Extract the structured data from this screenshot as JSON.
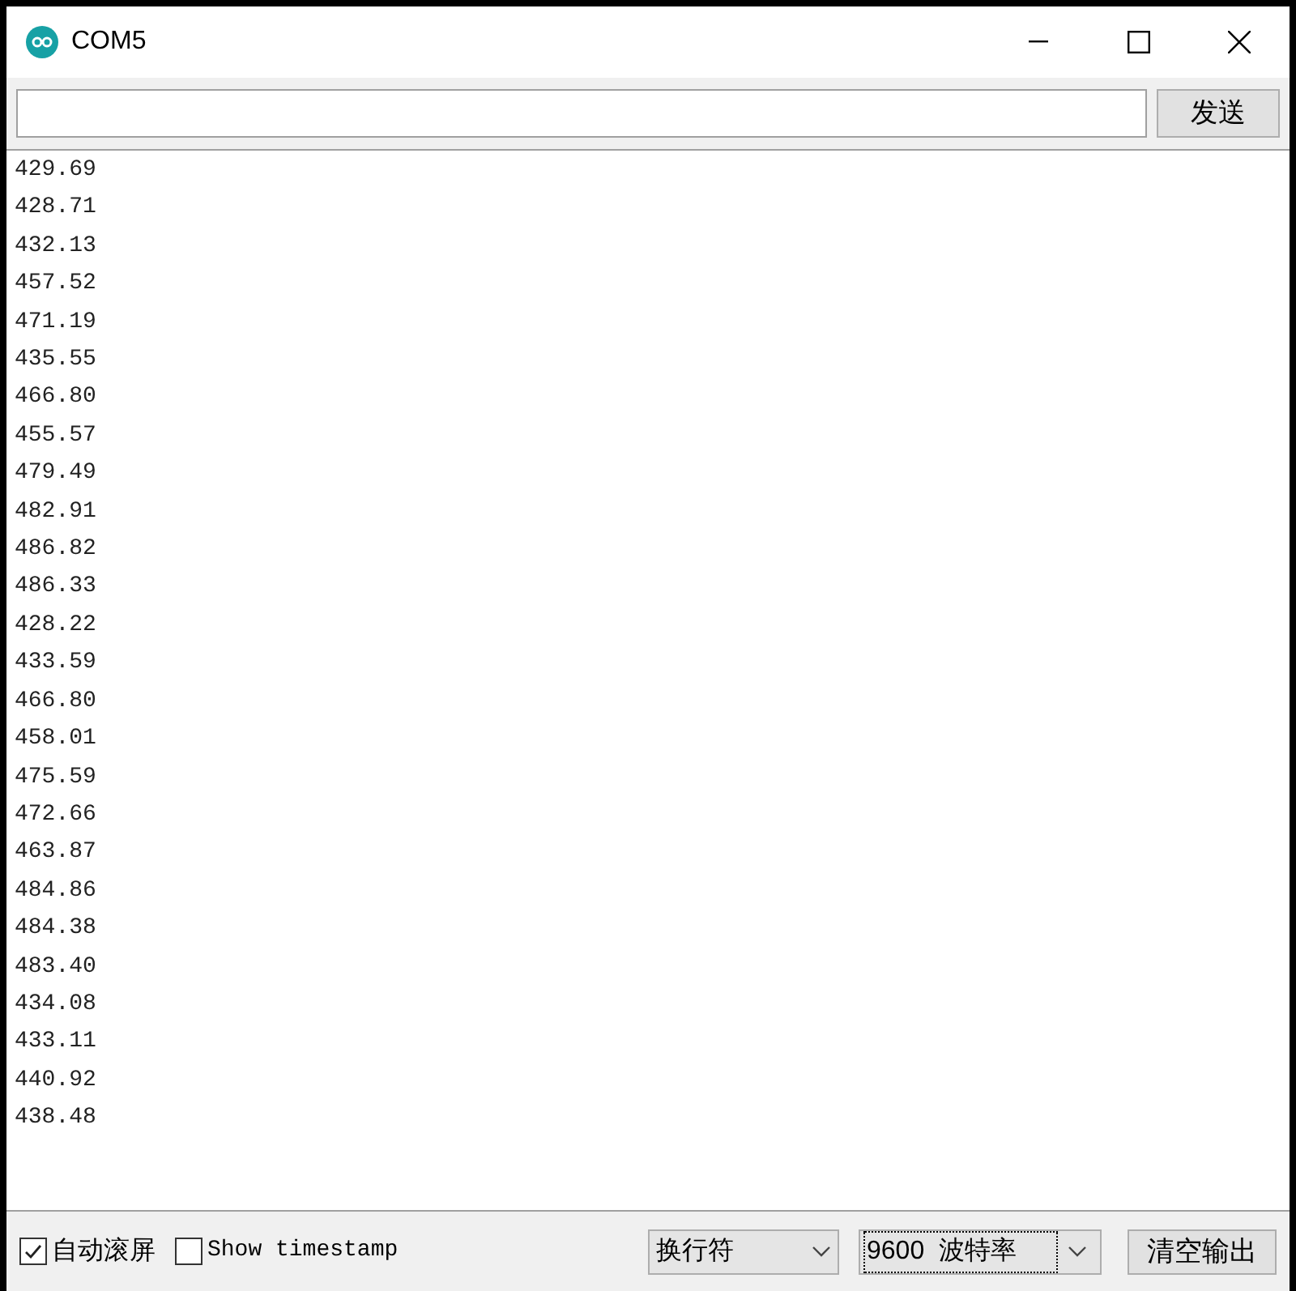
{
  "window": {
    "title": "COM5"
  },
  "send": {
    "button": "发送"
  },
  "output": [
    "429.69",
    "428.71",
    "432.13",
    "457.52",
    "471.19",
    "435.55",
    "466.80",
    "455.57",
    "479.49",
    "482.91",
    "486.82",
    "486.33",
    "428.22",
    "433.59",
    "466.80",
    "458.01",
    "475.59",
    "472.66",
    "463.87",
    "484.86",
    "484.38",
    "483.40",
    "434.08",
    "433.11",
    "440.92",
    "438.48"
  ],
  "options": [
    {
      "label": "自动滚屏",
      "checked": true
    },
    {
      "label": "Show timestamp",
      "checked": false
    }
  ],
  "line_ending": {
    "value": "换行符"
  },
  "baud_rate": {
    "value": "9600  波特率",
    "focused": true
  },
  "clear_button": "清空输出"
}
